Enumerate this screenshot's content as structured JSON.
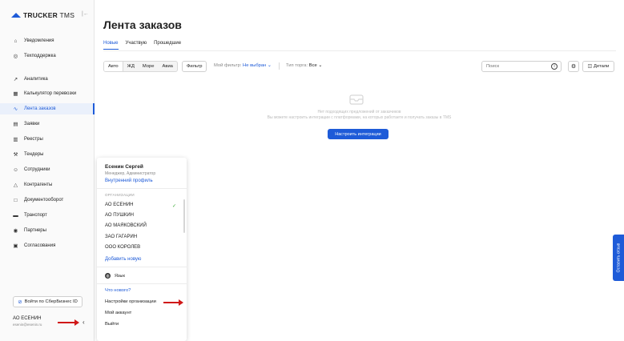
{
  "brand": {
    "name": "TRUCKER",
    "suffix": "TMS"
  },
  "sidebar": {
    "items": [
      {
        "label": "Уведомления",
        "icon": "bell-icon",
        "glyph": "⌂"
      },
      {
        "label": "Техподдержка",
        "icon": "support-icon",
        "glyph": "◎"
      },
      {
        "label": "Аналитика",
        "icon": "analytics-icon",
        "glyph": "↗"
      },
      {
        "label": "Калькулятор перевозки",
        "icon": "calculator-icon",
        "glyph": "▦"
      },
      {
        "label": "Лента заказов",
        "icon": "feed-icon",
        "glyph": "∿",
        "active": true
      },
      {
        "label": "Заявки",
        "icon": "requests-icon",
        "glyph": "▤"
      },
      {
        "label": "Реестры",
        "icon": "registers-icon",
        "glyph": "▥"
      },
      {
        "label": "Тендеры",
        "icon": "tenders-icon",
        "glyph": "⚒"
      },
      {
        "label": "Сотрудники",
        "icon": "employees-icon",
        "glyph": "☺"
      },
      {
        "label": "Контрагенты",
        "icon": "contractors-icon",
        "glyph": "△"
      },
      {
        "label": "Документооборот",
        "icon": "documents-icon",
        "glyph": "□"
      },
      {
        "label": "Транспорт",
        "icon": "truck-icon",
        "glyph": "▬"
      },
      {
        "label": "Партнеры",
        "icon": "partners-icon",
        "glyph": "◉"
      },
      {
        "label": "Согласования",
        "icon": "approvals-icon",
        "glyph": "▣"
      }
    ],
    "sber_button": "Войти по СберБизнес ID",
    "org_name": "АО ЕСЕНИН",
    "org_email": "esenin@esenin.ru"
  },
  "main": {
    "title": "Лента заказов",
    "tabs": [
      "Новые",
      "Участвую",
      "Прошедшие"
    ],
    "active_tab": "Новые",
    "filters": {
      "transport_types": [
        "Авто",
        "ЖД",
        "Море",
        "Авиа"
      ],
      "selected_transport": "Авто",
      "filter_button": "Фильтр",
      "my_filter_label": "Мой фильтр:",
      "my_filter_value": "Не выбран",
      "trade_type_label": "Тип торга:",
      "trade_type_value": "Все",
      "search_placeholder": "Поиск",
      "details_button": "Детали"
    },
    "empty": {
      "line1": "Нет подходящих предложений от заказчиков",
      "line2": "Вы можете настроить интеграции с платформами, на которых работаете и получать заказы в TMS",
      "button": "Настроить интеграции"
    },
    "feedback_tab": "Оставить отзыв"
  },
  "profile_menu": {
    "user_name": "Есенин Сергей",
    "role": "Менеджер, Администратор",
    "internal_profile": "Внутренний профиль",
    "orgs_title": "ОРГАНИЗАЦИИ",
    "orgs": [
      "АО ЕСЕНИН",
      "АО ПУШКИН",
      "АО МАЯКОВСКИЙ",
      "ЗАО ГАГАРИН",
      "ООО КОРОЛЕВ"
    ],
    "current_org": "АО ЕСЕНИН",
    "add_new": "Добавить новую",
    "language": "Язык",
    "whats_new": "Что нового?",
    "org_settings": "Настройки организации",
    "my_account": "Мой аккаунт",
    "logout": "Выйти"
  },
  "colors": {
    "accent": "#1e5bd8",
    "annotation_arrow": "#d01818",
    "check": "#3aaa35"
  }
}
